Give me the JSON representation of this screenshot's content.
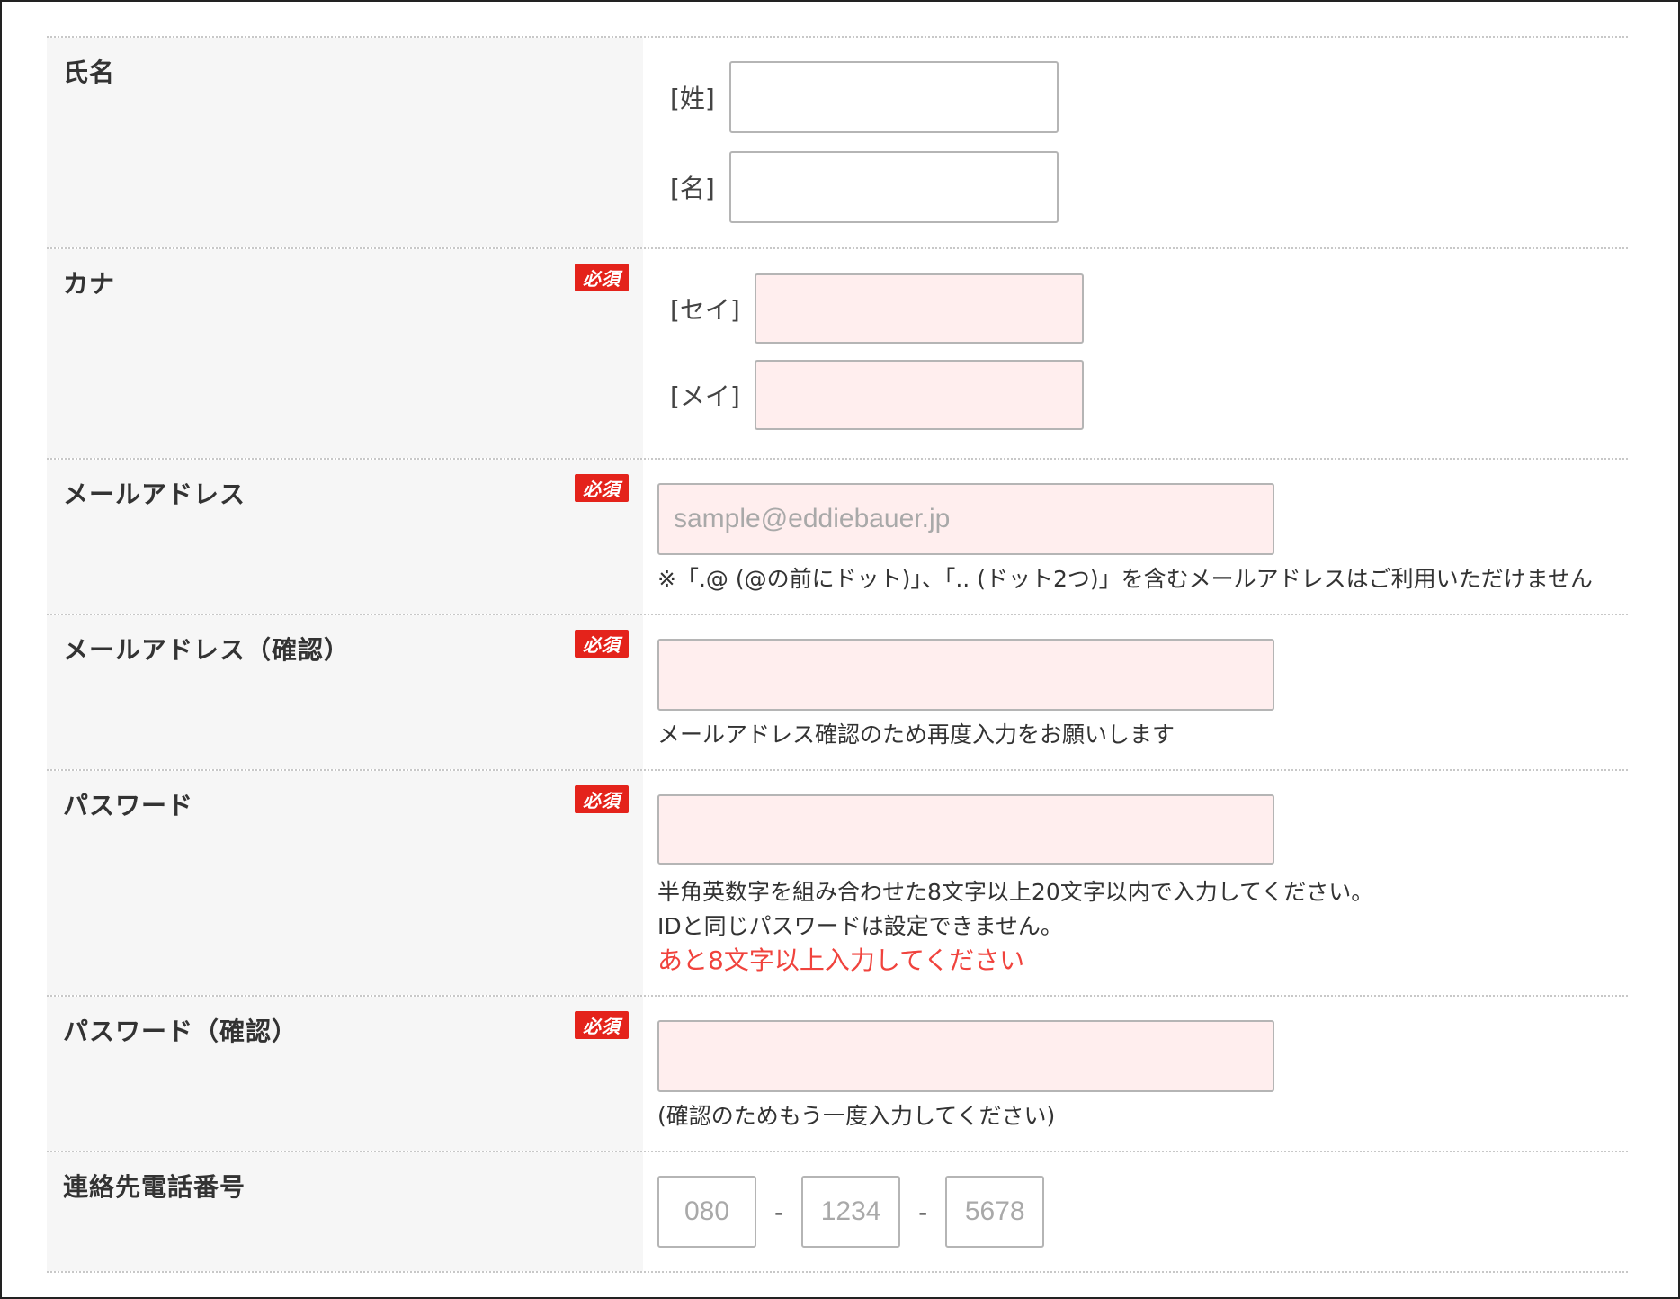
{
  "required_badge": "必須",
  "name": {
    "label": "氏名",
    "last_bracket": "[姓]",
    "first_bracket": "[名]",
    "last_value": "",
    "first_value": ""
  },
  "kana": {
    "label": "カナ",
    "last_bracket": "[セイ]",
    "first_bracket": "[メイ]",
    "last_value": "",
    "first_value": ""
  },
  "email": {
    "label": "メールアドレス",
    "placeholder": "sample@eddiebauer.jp",
    "note": "※「.@ (@の前にドット)」、「.. (ドット2つ)」を含むメールアドレスはご利用いただけません"
  },
  "email_confirm": {
    "label": "メールアドレス（確認）",
    "note": "メールアドレス確認のため再度入力をお願いします"
  },
  "password": {
    "label": "パスワード",
    "note1": "半角英数字を組み合わせた8文字以上20文字以内で入力してください。",
    "note2": "IDと同じパスワードは設定できません。",
    "error": "あと8文字以上入力してください"
  },
  "password_confirm": {
    "label": "パスワード（確認）",
    "note": "(確認のためもう一度入力してください)"
  },
  "phone": {
    "label": "連絡先電話番号",
    "placeholder1": "080",
    "placeholder2": "1234",
    "placeholder3": "5678",
    "separator": "-"
  },
  "colors": {
    "required_badge": "#e4231b",
    "input_error_bg": "#ffeeee",
    "error_text": "#f0433d",
    "label_bg": "#f6f6f6"
  }
}
